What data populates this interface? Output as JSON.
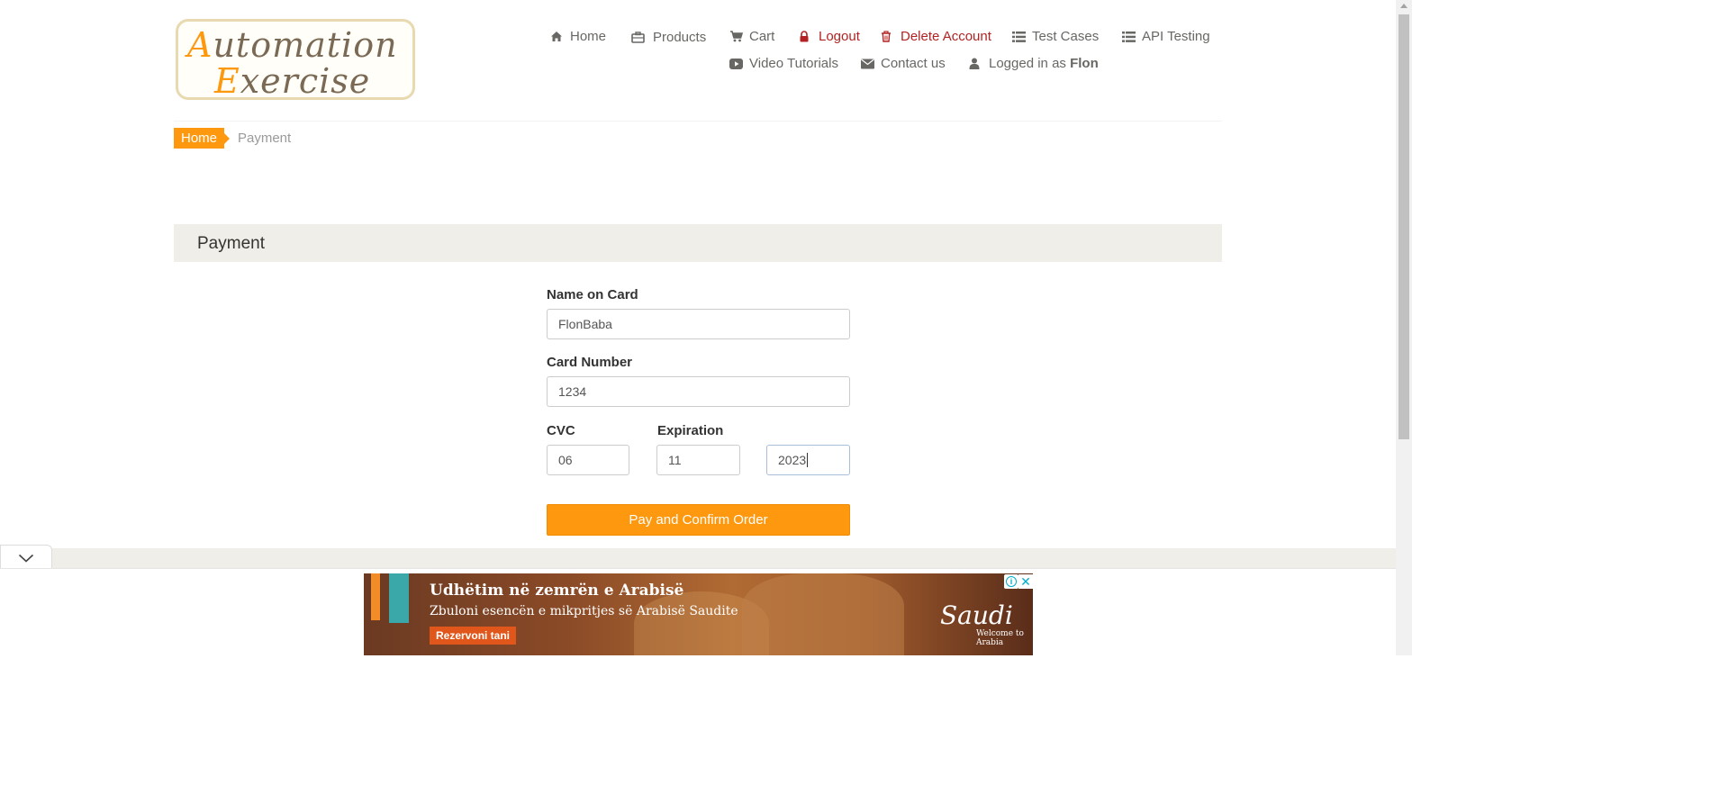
{
  "logo": {
    "line1_cap": "A",
    "line1_rest": "utomation",
    "line2_cap": "E",
    "line2_rest": "xercise"
  },
  "nav": {
    "home": "Home",
    "products": "Products",
    "cart": "Cart",
    "logout": "Logout",
    "delete_account": "Delete Account",
    "test_cases": "Test Cases",
    "api_testing": "API Testing",
    "video_tutorials": "Video Tutorials",
    "contact_us": "Contact us",
    "logged_in_prefix": "Logged in as",
    "logged_in_user": "Flon"
  },
  "breadcrumb": {
    "home": "Home",
    "current": "Payment"
  },
  "section": {
    "title": "Payment"
  },
  "form": {
    "name_label": "Name on Card",
    "name_value": "FlonBaba",
    "card_label": "Card Number",
    "card_value": "1234",
    "cvc_label": "CVC",
    "cvc_value": "06",
    "expiration_label": "Expiration",
    "exp_month_value": "11",
    "exp_year_value": "2023",
    "submit_label": "Pay and Confirm Order"
  },
  "ad": {
    "headline": "Udhëtim në zemrën e Arabisë",
    "subline": "Zbuloni esencën e mikpritjes së Arabisë Saudite",
    "cta": "Rezervoni tani",
    "brand": "Saudi",
    "brand_tagline": "Welcome to Arabia"
  },
  "colors": {
    "accent": "#fe980f",
    "danger": "#b22222",
    "section_bg": "#efeee8"
  }
}
